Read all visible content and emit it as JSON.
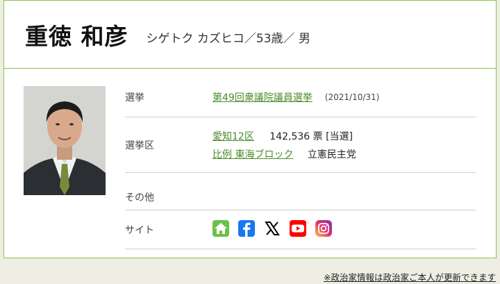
{
  "header": {
    "name": "重徳 和彦",
    "sub_info": "シゲトク カズヒコ／53歳／ 男"
  },
  "rows": {
    "election": {
      "label": "選挙",
      "link": "第49回衆議院議員選挙",
      "date": "(2021/10/31)"
    },
    "district": {
      "label": "選挙区",
      "district_link": "愛知12区",
      "votes": "142,536 票 [当選]",
      "pr_link": "比例 東海ブロック",
      "party": "立憲民主党"
    },
    "other": {
      "label": "その他"
    },
    "site": {
      "label": "サイト"
    }
  },
  "sns": [
    {
      "icon": "home-icon",
      "color": "#6cc04a"
    },
    {
      "icon": "facebook-icon",
      "color": "#1877f2"
    },
    {
      "icon": "x-icon",
      "color": "#000000"
    },
    {
      "icon": "youtube-icon",
      "color": "#ff0000"
    },
    {
      "icon": "instagram-icon",
      "color": "#d6249f"
    }
  ],
  "footer": {
    "note": "※政治家情報は政治家ご本人が更新できます"
  }
}
